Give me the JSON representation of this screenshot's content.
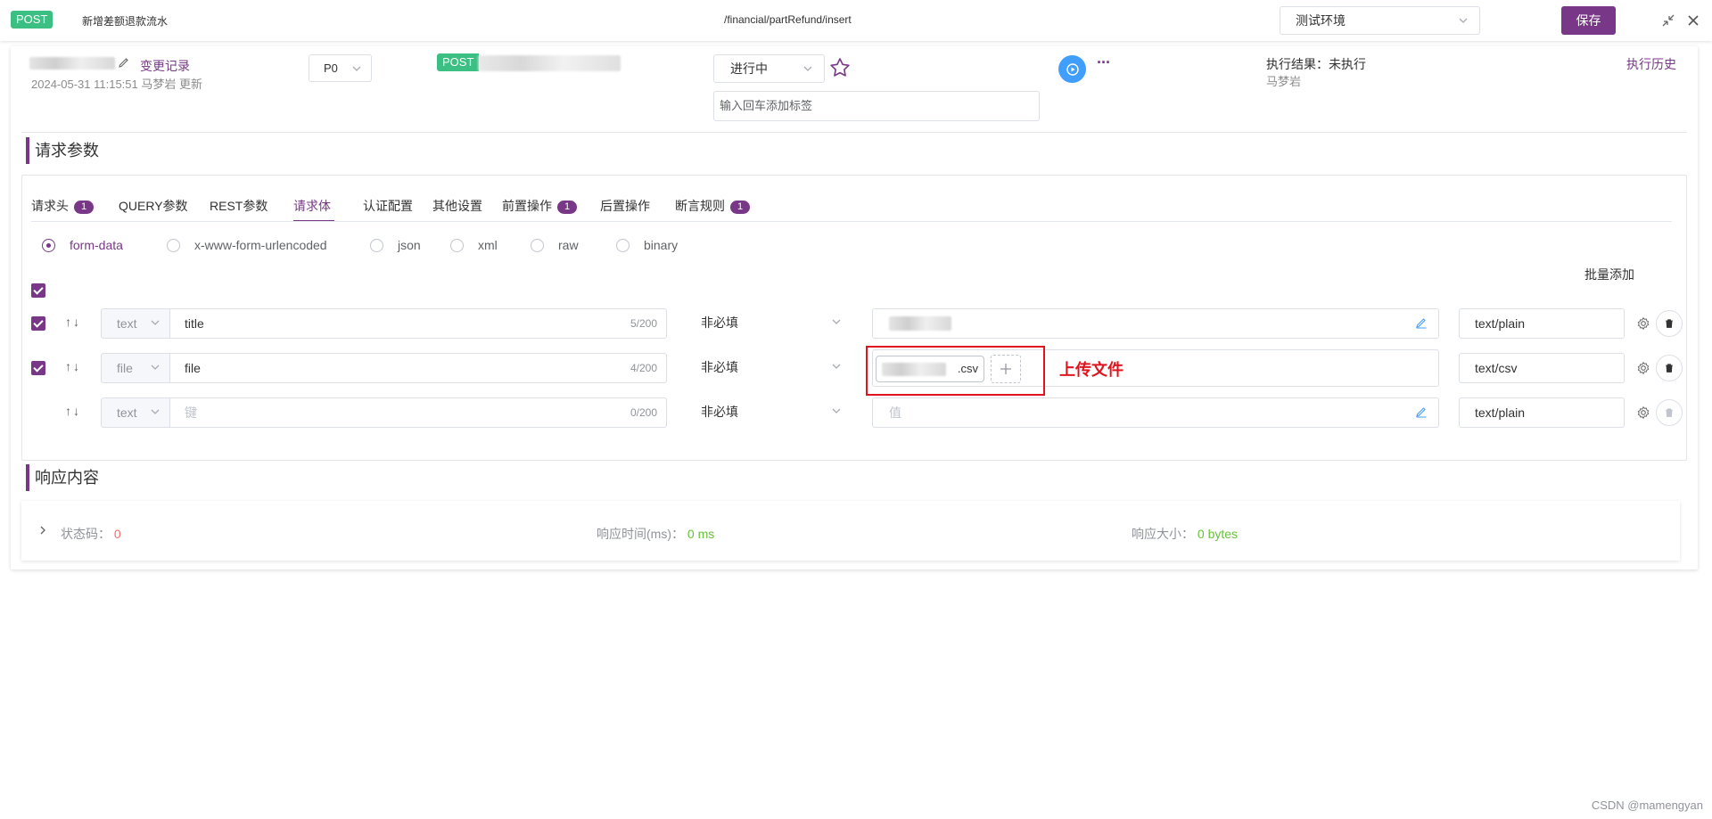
{
  "topbar": {
    "method": "POST",
    "title": "新增差额退款流水",
    "path": "/financial/partRefund/insert",
    "environment": "测试环境",
    "save_label": "保存"
  },
  "info": {
    "change_log_label": "变更记录",
    "updated_text": "2024-05-31 11:15:51 马梦岩 更新",
    "priority": "P0",
    "method_tag": "POST",
    "status": "进行中",
    "tag_placeholder": "输入回车添加标签",
    "exec_result_label": "执行结果：",
    "exec_result_value": "未执行",
    "executor": "马梦岩",
    "exec_history_label": "执行历史"
  },
  "request": {
    "section_title": "请求参数",
    "tabs": [
      {
        "label": "请求头",
        "badge": "1"
      },
      {
        "label": "QUERY参数",
        "badge": ""
      },
      {
        "label": "REST参数",
        "badge": ""
      },
      {
        "label": "请求体",
        "badge": ""
      },
      {
        "label": "认证配置",
        "badge": ""
      },
      {
        "label": "其他设置",
        "badge": ""
      },
      {
        "label": "前置操作",
        "badge": "1"
      },
      {
        "label": "后置操作",
        "badge": ""
      },
      {
        "label": "断言规则",
        "badge": "1"
      }
    ],
    "active_tab": "请求体",
    "body_types": [
      "form-data",
      "x-www-form-urlencoded",
      "json",
      "xml",
      "raw",
      "binary"
    ],
    "selected_body_type": "form-data",
    "batch_add_label": "批量添加",
    "rows": [
      {
        "type": "text",
        "key": "title",
        "count": "5/200",
        "required": "非必填",
        "content_type": "text/plain",
        "checked": true
      },
      {
        "type": "file",
        "key": "file",
        "count": "4/200",
        "required": "非必填",
        "file_ext": ".csv",
        "content_type": "text/csv",
        "checked": true
      },
      {
        "type": "text",
        "key_placeholder": "键",
        "count": "0/200",
        "required": "非必填",
        "value_placeholder": "值",
        "content_type": "text/plain",
        "checked": false
      }
    ],
    "annotation": "上传文件",
    "annotation_color": "#e0141e"
  },
  "response": {
    "section_title": "响应内容",
    "status_label": "状态码：",
    "status_value": "0",
    "time_label": "响应时间(ms)：",
    "time_value": "0 ms",
    "size_label": "响应大小：",
    "size_value": "0 bytes"
  },
  "watermark": "CSDN @mamengyan",
  "colors": {
    "accent": "#783887",
    "post_green": "#3cbf83",
    "run_blue": "#409eff"
  }
}
